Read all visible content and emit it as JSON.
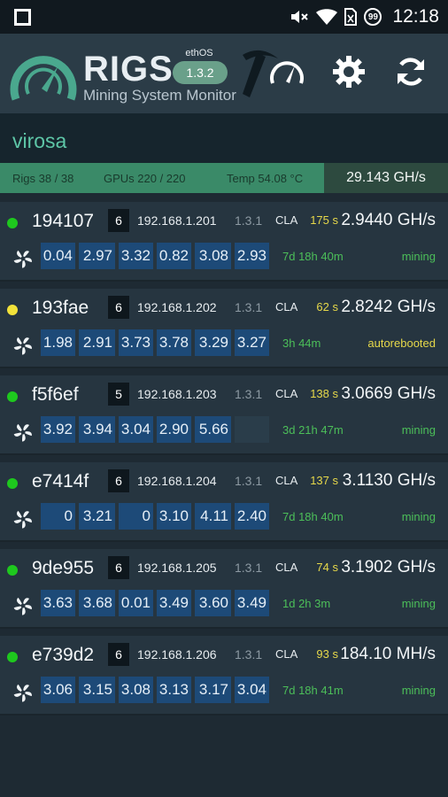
{
  "statusbar": {
    "time": "12:18",
    "badge": "99"
  },
  "header": {
    "title": "RIGS",
    "subtitle": "Mining System Monitor",
    "ethos_label": "ethOS",
    "ethos_version": "1.3.2",
    "icons": [
      "speedometer-icon",
      "settings-gear-icon",
      "refresh-icon"
    ]
  },
  "farm": {
    "name": "virosa"
  },
  "summary": {
    "rigs": "Rigs 38 / 38",
    "gpus": "GPUs 220 / 220",
    "temp": "Temp 54.08 °C",
    "hashrate": "29.143 GH/s"
  },
  "colors": {
    "online": "#1ec81e",
    "warning": "#f2e23a",
    "green_text": "#4cbf59",
    "yellow_text": "#e6d84a",
    "cell_blue": "#1d4a78"
  },
  "rigs": [
    {
      "name": "194107",
      "status_color": "online",
      "gpus": "6",
      "ip": "192.168.1.201",
      "version": "1.3.1",
      "miner": "CLA",
      "secs": "175 s",
      "hashrate": "2.9440 GH/s",
      "gpu_hashes": [
        "0.04",
        "2.97",
        "3.32",
        "0.82",
        "3.08",
        "2.93"
      ],
      "uptime": "7d 18h 40m",
      "state": "mining"
    },
    {
      "name": "193fae",
      "status_color": "warning",
      "gpus": "6",
      "ip": "192.168.1.202",
      "version": "1.3.1",
      "miner": "CLA",
      "secs": "62 s",
      "hashrate": "2.8242 GH/s",
      "gpu_hashes": [
        "1.98",
        "2.91",
        "3.73",
        "3.78",
        "3.29",
        "3.27"
      ],
      "uptime": "3h 44m",
      "state": "autorebooted"
    },
    {
      "name": "f5f6ef",
      "status_color": "online",
      "gpus": "5",
      "ip": "192.168.1.203",
      "version": "1.3.1",
      "miner": "CLA",
      "secs": "138 s",
      "hashrate": "3.0669 GH/s",
      "gpu_hashes": [
        "3.92",
        "3.94",
        "3.04",
        "2.90",
        "5.66",
        ""
      ],
      "uptime": "3d 21h 47m",
      "state": "mining"
    },
    {
      "name": "e7414f",
      "status_color": "online",
      "gpus": "6",
      "ip": "192.168.1.204",
      "version": "1.3.1",
      "miner": "CLA",
      "secs": "137 s",
      "hashrate": "3.1130 GH/s",
      "gpu_hashes": [
        "0",
        "3.21",
        "0",
        "3.10",
        "4.11",
        "2.40"
      ],
      "uptime": "7d 18h 40m",
      "state": "mining"
    },
    {
      "name": "9de955",
      "status_color": "online",
      "gpus": "6",
      "ip": "192.168.1.205",
      "version": "1.3.1",
      "miner": "CLA",
      "secs": "74 s",
      "hashrate": "3.1902 GH/s",
      "gpu_hashes": [
        "3.63",
        "3.68",
        "0.01",
        "3.49",
        "3.60",
        "3.49"
      ],
      "uptime": "1d 2h 3m",
      "state": "mining"
    },
    {
      "name": "e739d2",
      "status_color": "online",
      "gpus": "6",
      "ip": "192.168.1.206",
      "version": "1.3.1",
      "miner": "CLA",
      "secs": "93 s",
      "hashrate": "184.10 MH/s",
      "gpu_hashes": [
        "3.06",
        "3.15",
        "3.08",
        "3.13",
        "3.17",
        "3.04"
      ],
      "uptime": "7d 18h 41m",
      "state": "mining"
    }
  ]
}
